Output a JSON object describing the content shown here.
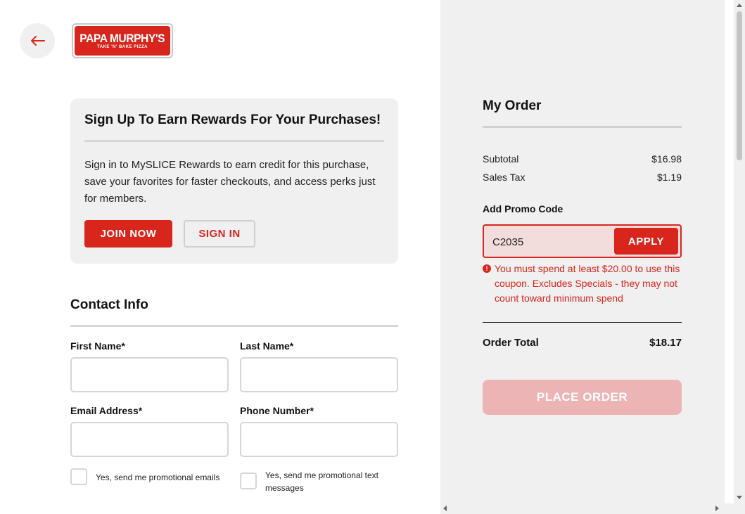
{
  "header": {
    "back_icon": "arrow-left-icon",
    "logo_main": "PAPA MURPHY'S",
    "logo_tagline": "TAKE 'N' BAKE PIZZA"
  },
  "rewards": {
    "title": "Sign Up To Earn Rewards For Your Purchases!",
    "text": "Sign in to MySLICE Rewards to earn credit for this purchase, save your favorites for faster checkouts, and access perks just for members.",
    "join_label": "JOIN NOW",
    "signin_label": "SIGN IN"
  },
  "contact": {
    "title": "Contact Info",
    "first_name_label": "First Name*",
    "first_name_value": "",
    "last_name_label": "Last Name*",
    "last_name_value": "",
    "email_label": "Email Address*",
    "email_value": "",
    "phone_label": "Phone Number*",
    "phone_value": "",
    "promo_emails_label": "Yes, send me promotional emails",
    "promo_texts_label": "Yes, send me promotional text messages"
  },
  "order": {
    "title": "My Order",
    "subtotal_label": "Subtotal",
    "subtotal_value": "$16.98",
    "tax_label": "Sales Tax",
    "tax_value": "$1.19",
    "promo_label": "Add Promo Code",
    "promo_value": "C2035",
    "apply_label": "APPLY",
    "error_icon": "alert-circle-icon",
    "error_text": "You must spend at least $20.00 to use this coupon. Excludes Specials - they may not count toward minimum spend",
    "total_label": "Order Total",
    "total_value": "$18.17",
    "place_order_label": "PLACE ORDER"
  },
  "colors": {
    "brand_red": "#d9261c",
    "disabled_button": "#ecb4b4",
    "panel_gray": "#f0f0f0"
  }
}
